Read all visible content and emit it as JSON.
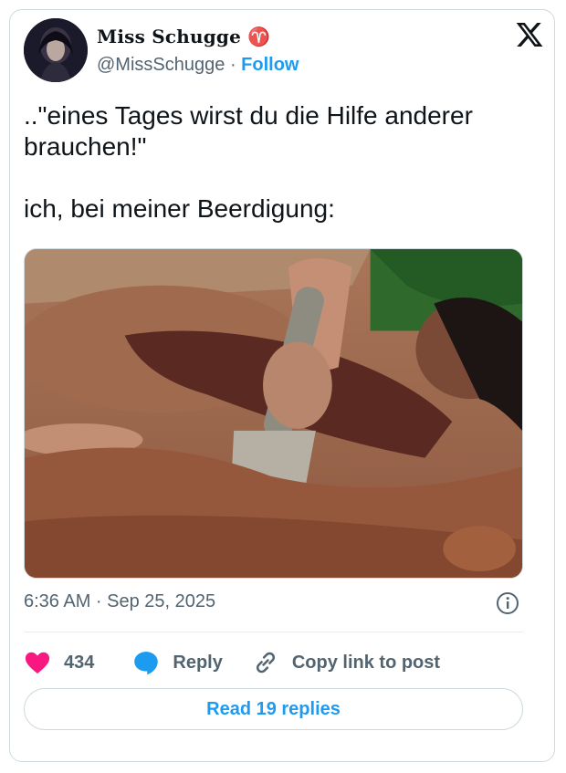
{
  "author": {
    "display_name": "Miss Schugge",
    "handle": "@MissSchugge",
    "separator": "·",
    "follow_label": "Follow"
  },
  "tweet": {
    "text": "..\"eines Tages wirst du die Hilfe anderer brauchen!\"\n\nich, bei meiner Beerdigung:",
    "timestamp": "6:36 AM · Sep 25, 2025"
  },
  "actions": {
    "likes_count": "434",
    "reply_label": "Reply",
    "copy_link_label": "Copy link to post"
  },
  "read_replies_label": "Read 19 replies",
  "icons": {
    "platform": "x-logo-icon",
    "like": "heart-icon",
    "reply": "speech-bubble-icon",
    "copy_link": "link-icon",
    "info": "info-icon",
    "name_badge": "gothic-glyph-icon"
  },
  "colors": {
    "accent": "#1d9bf0",
    "like": "#f91880",
    "text": "#0f1419",
    "muted": "#536471",
    "border": "#cfd9de"
  }
}
